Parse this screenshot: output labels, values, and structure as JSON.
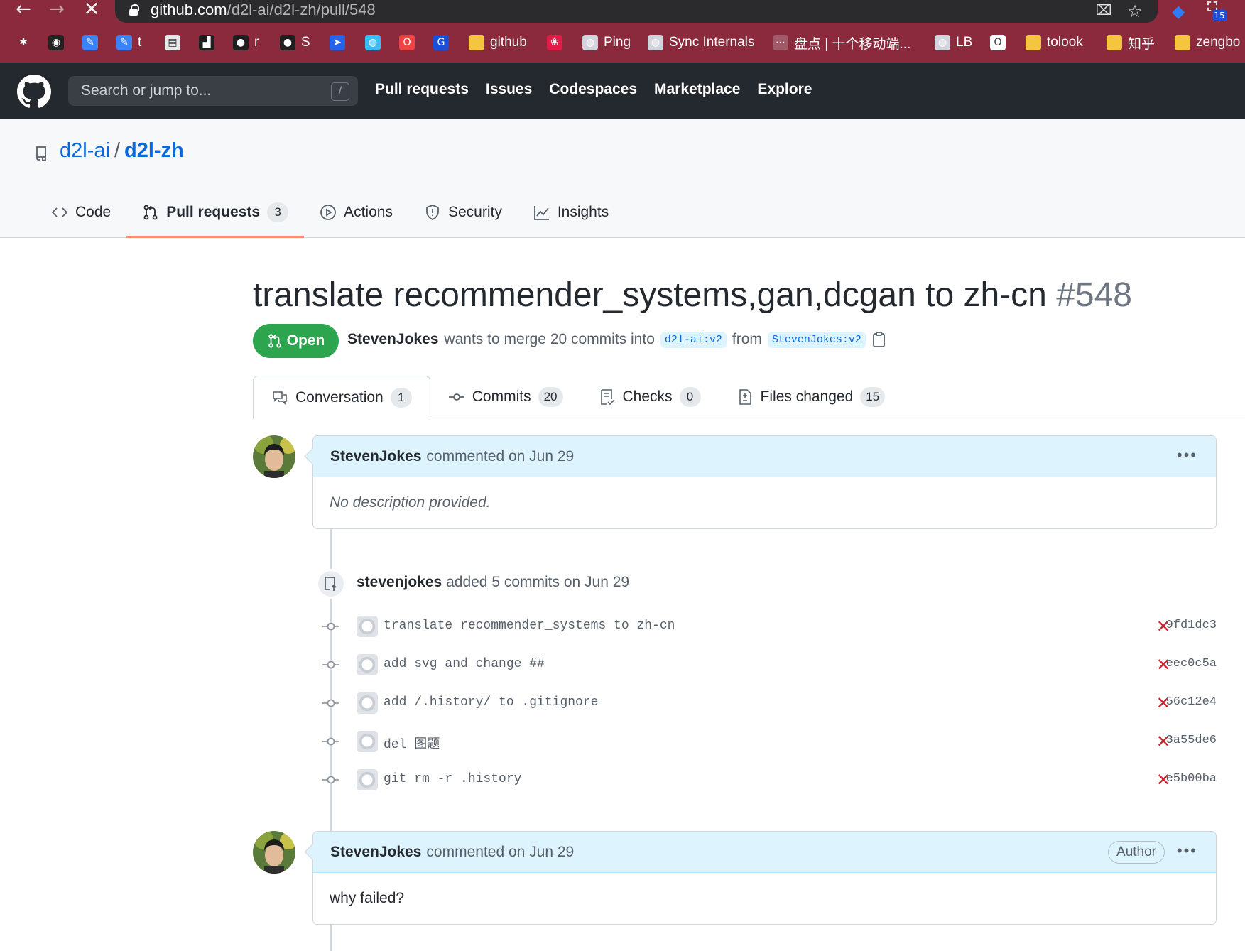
{
  "browser": {
    "url_host": "github.com",
    "url_path": "/d2l-ai/d2l-zh/pull/548",
    "extension_badge": "15",
    "bookmarks": [
      {
        "label": "",
        "icon": "gear-icon",
        "color": "#8a2a3c"
      },
      {
        "label": "",
        "icon": "panda-icon",
        "color": "#222222"
      },
      {
        "label": "",
        "icon": "note-icon",
        "color": "#3b82f6"
      },
      {
        "label": "t",
        "icon": "note-icon",
        "color": "#3b82f6"
      },
      {
        "label": "",
        "icon": "doc-icon",
        "color": "#e8e8e8"
      },
      {
        "label": "",
        "icon": "chart-icon",
        "color": "#1f1f1f"
      },
      {
        "label": "r",
        "icon": "github-icon",
        "color": "#1f1f1f"
      },
      {
        "label": "S",
        "icon": "github-icon",
        "color": "#1f1f1f"
      },
      {
        "label": "",
        "icon": "arrow-icon",
        "color": "#2563eb"
      },
      {
        "label": "",
        "icon": "globe-icon",
        "color": "#38bdf8"
      },
      {
        "label": "",
        "icon": "opera-icon",
        "color": "#ef4444"
      },
      {
        "label": "",
        "icon": "g-icon",
        "color": "#1d4ed8"
      },
      {
        "label": "github",
        "icon": "folder-icon",
        "color": "#f5c542"
      },
      {
        "label": "",
        "icon": "huawei-icon",
        "color": "#e11d48"
      },
      {
        "label": "Ping",
        "icon": "globe-icon",
        "color": "#d1d5db"
      },
      {
        "label": "Sync Internals",
        "icon": "globe-icon",
        "color": "#d1d5db"
      },
      {
        "label": "盘点 | 十个移动端...",
        "icon": "dots-icon",
        "color": "#a15a6a"
      },
      {
        "label": "LB",
        "icon": "globe-icon",
        "color": "#d1d5db"
      },
      {
        "label": "",
        "icon": "o-icon",
        "color": "#ffffff"
      },
      {
        "label": "tolook",
        "icon": "folder-icon",
        "color": "#f5c542"
      },
      {
        "label": "知乎",
        "icon": "folder-icon",
        "color": "#f5c542"
      },
      {
        "label": "zengbo",
        "icon": "folder-icon",
        "color": "#f5c542"
      }
    ]
  },
  "github": {
    "search_placeholder": "Search or jump to...",
    "search_shortcut": "/",
    "nav": [
      "Pull requests",
      "Issues",
      "Codespaces",
      "Marketplace",
      "Explore"
    ]
  },
  "repo": {
    "owner": "d2l-ai",
    "separator": "/",
    "name": "d2l-zh",
    "tabs": [
      {
        "label": "Code",
        "icon": "code-icon",
        "count": ""
      },
      {
        "label": "Pull requests",
        "icon": "pull-request-icon",
        "count": "3"
      },
      {
        "label": "Actions",
        "icon": "play-icon",
        "count": ""
      },
      {
        "label": "Security",
        "icon": "shield-icon",
        "count": ""
      },
      {
        "label": "Insights",
        "icon": "graph-icon",
        "count": ""
      }
    ]
  },
  "pr": {
    "title": "translate recommender_systems,gan,dcgan to zh-cn",
    "number": "#548",
    "state": "Open",
    "author": "StevenJokes",
    "merge_text": "wants to merge 20 commits into",
    "base_branch": "d2l-ai:v2",
    "from_text": "from",
    "head_branch": "StevenJokes:v2",
    "tabs": [
      {
        "label": "Conversation",
        "icon": "comment-icon",
        "count": "1"
      },
      {
        "label": "Commits",
        "icon": "commit-icon",
        "count": "20"
      },
      {
        "label": "Checks",
        "icon": "checklist-icon",
        "count": "0"
      },
      {
        "label": "Files changed",
        "icon": "file-diff-icon",
        "count": "15"
      }
    ]
  },
  "timeline": {
    "comment1": {
      "author": "StevenJokes",
      "meta": "commented on Jun 29",
      "body": "No description provided."
    },
    "commits_event": {
      "actor": "stevenjokes",
      "text": "added 5 commits on Jun 29"
    },
    "commits": [
      {
        "message": "translate recommender_systems to zh-cn",
        "status": "✕",
        "sha": "9fd1dc3"
      },
      {
        "message": "add svg and change ##",
        "status": "✕",
        "sha": "eec0c5a"
      },
      {
        "message": "add /.history/ to .gitignore",
        "status": "✕",
        "sha": "56c12e4"
      },
      {
        "message": "del 图题",
        "status": "✕",
        "sha": "3a55de6"
      },
      {
        "message": "git rm -r .history",
        "status": "✕",
        "sha": "e5b00ba"
      }
    ],
    "comment2": {
      "author": "StevenJokes",
      "meta": "commented on Jun 29",
      "badge": "Author",
      "body": "why failed?"
    }
  },
  "colors": {
    "chrome": "#8a2a3c",
    "header": "#24292f",
    "open_green": "#2da44e",
    "link_blue": "#0969da",
    "fail_red": "#cf222e"
  }
}
